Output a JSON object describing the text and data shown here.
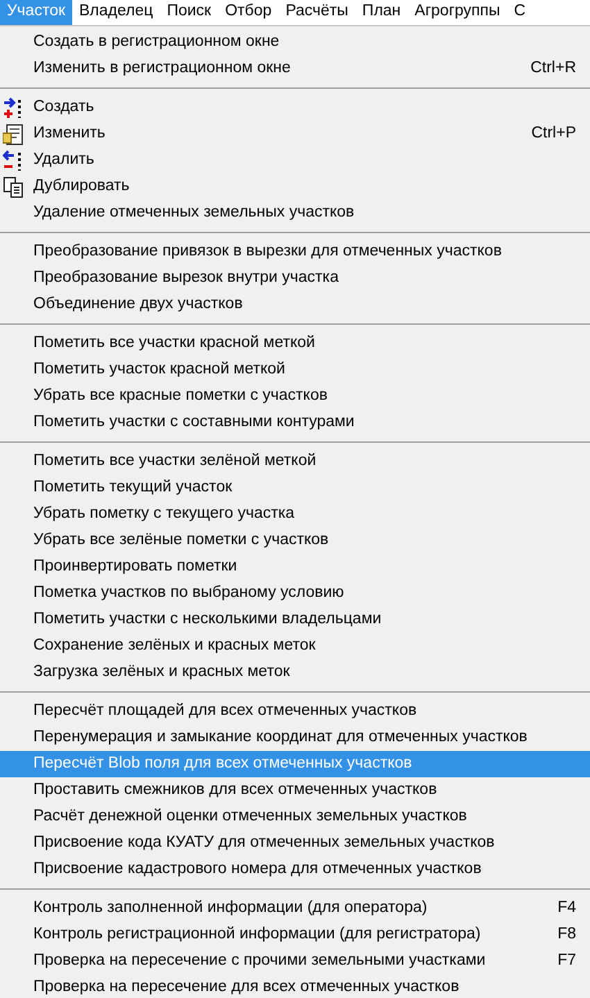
{
  "menubar": [
    {
      "label": "Участок",
      "selected": true
    },
    {
      "label": "Владелец",
      "selected": false
    },
    {
      "label": "Поиск",
      "selected": false
    },
    {
      "label": "Отбор",
      "selected": false
    },
    {
      "label": "Расчёты",
      "selected": false
    },
    {
      "label": "План",
      "selected": false
    },
    {
      "label": "Агрогруппы",
      "selected": false
    },
    {
      "label": "С",
      "selected": false
    }
  ],
  "menu": {
    "groups": [
      [
        {
          "label": "Создать в регистрационном окне",
          "kind": "plain",
          "selected": false
        },
        {
          "label": "Изменить в регистрационном окне",
          "shortcut": "Ctrl+R",
          "kind": "plain",
          "selected": false
        }
      ],
      [
        {
          "label": "Создать",
          "kind": "icon",
          "selected": false
        },
        {
          "label": "Изменить",
          "shortcut": "Ctrl+P",
          "kind": "icon",
          "selected": false
        },
        {
          "label": "Удалить",
          "kind": "icon",
          "selected": false
        },
        {
          "label": "Дублировать",
          "kind": "icon",
          "selected": false
        },
        {
          "label": "Удаление отмеченных земельных участков",
          "kind": "plain",
          "selected": false
        }
      ],
      [
        {
          "label": "Преобразование привязок в вырезки для отмеченных участков",
          "kind": "plain",
          "selected": false
        },
        {
          "label": "Преобразование вырезок внутри участка",
          "kind": "plain",
          "selected": false
        },
        {
          "label": "Объединение двух участков",
          "kind": "plain",
          "selected": false
        }
      ],
      [
        {
          "label": "Пометить все участки красной меткой",
          "kind": "plain",
          "selected": false
        },
        {
          "label": "Пометить участок красной меткой",
          "kind": "plain",
          "selected": false
        },
        {
          "label": "Убрать все красные пометки с участков",
          "kind": "plain",
          "selected": false
        },
        {
          "label": "Пометить участки с составными контурами",
          "kind": "plain",
          "selected": false
        }
      ],
      [
        {
          "label": "Пометить все участки зелёной меткой",
          "kind": "plain",
          "selected": false
        },
        {
          "label": "Пометить текущий участок",
          "kind": "plain",
          "selected": false
        },
        {
          "label": "Убрать пометку с текущего участка",
          "kind": "plain",
          "selected": false
        },
        {
          "label": "Убрать все зелёные пометки с участков",
          "kind": "plain",
          "selected": false
        },
        {
          "label": "Проинвертировать пометки",
          "kind": "plain",
          "selected": false
        },
        {
          "label": "Пометка участков по выбраному условию",
          "kind": "plain",
          "selected": false
        },
        {
          "label": "Пометить участки с несколькими владельцами",
          "kind": "plain",
          "selected": false
        },
        {
          "label": "Сохранение зелёных и красных меток",
          "kind": "plain",
          "selected": false
        },
        {
          "label": "Загрузка зелёных и красных меток",
          "kind": "plain",
          "selected": false
        }
      ],
      [
        {
          "label": "Пересчёт площадей для всех отмеченных участков",
          "kind": "plain",
          "selected": false
        },
        {
          "label": "Перенумерация и замыкание координат для отмеченных участков",
          "kind": "plain",
          "selected": false
        },
        {
          "label": "Пересчёт Blob поля для всех отмеченных участков",
          "kind": "plain",
          "selected": true
        },
        {
          "label": "Проставить смежников для всех отмеченных участков",
          "kind": "plain",
          "selected": false
        },
        {
          "label": "Расчёт денежной оценки отмеченных земельных участков",
          "kind": "plain",
          "selected": false
        },
        {
          "label": "Присвоение кода КУАТУ для отмеченных земельных участков",
          "kind": "plain",
          "selected": false
        },
        {
          "label": "Присвоение кадастрового номера для отмеченных участков",
          "kind": "plain",
          "selected": false
        }
      ],
      [
        {
          "label": "Контроль заполненной информации (для оператора)",
          "shortcut": "F4",
          "kind": "plain",
          "selected": false
        },
        {
          "label": "Контроль регистрационной информации (для регистратора)",
          "shortcut": "F8",
          "kind": "plain",
          "selected": false
        },
        {
          "label": "Проверка на пересечение с прочими земельными участками",
          "shortcut": "F7",
          "kind": "plain",
          "selected": false
        },
        {
          "label": "Проверка на пересечение для всех отмеченных участков",
          "kind": "plain",
          "selected": false
        }
      ]
    ]
  }
}
